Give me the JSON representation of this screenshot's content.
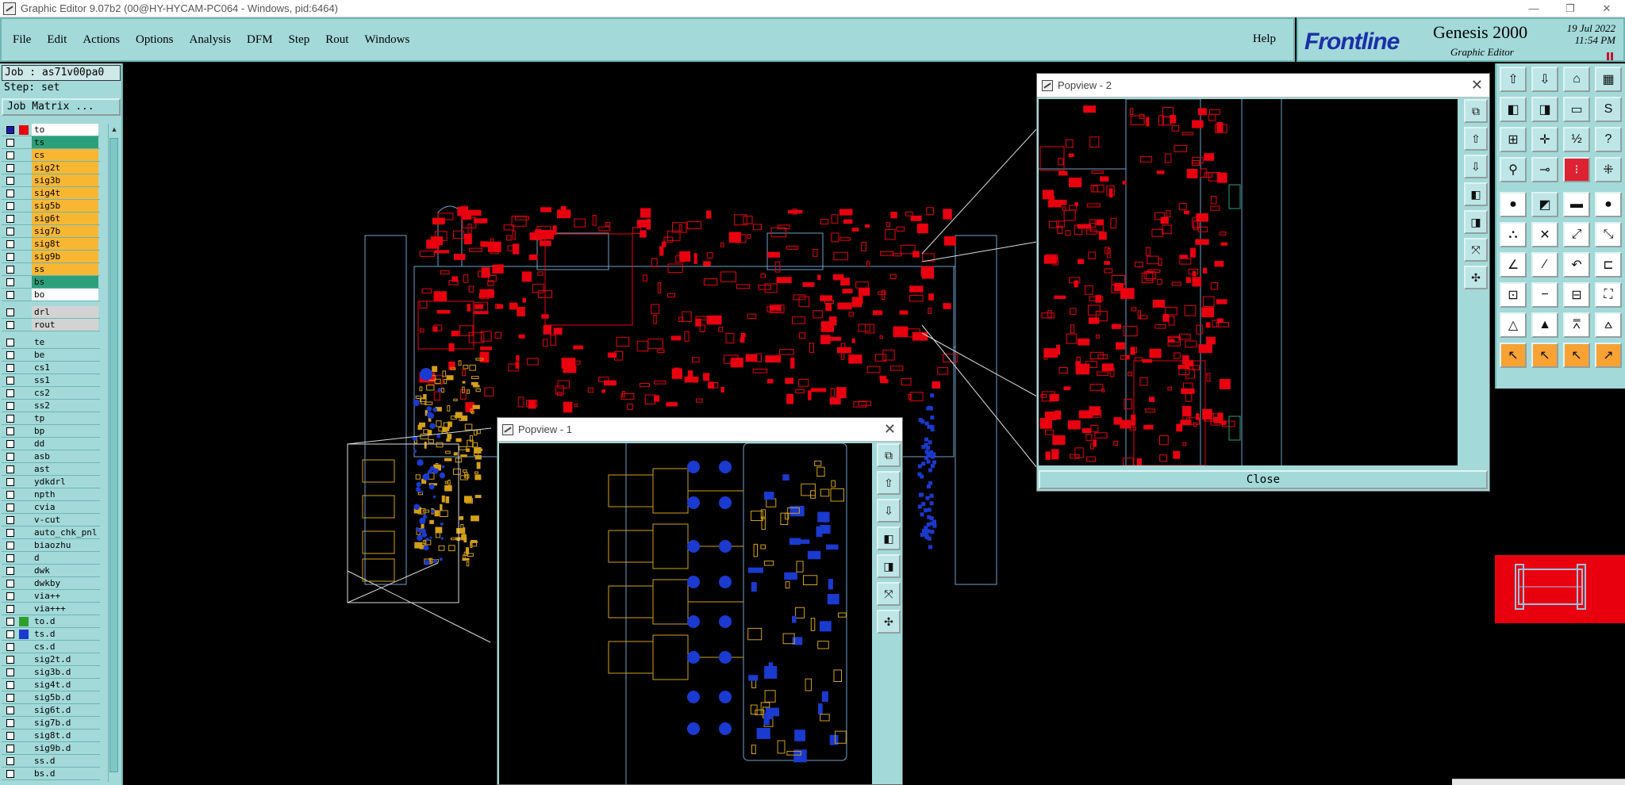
{
  "window": {
    "title": "Graphic Editor 9.07b2 (00@HY-HYCAM-PC064 - Windows, pid:6464)",
    "min_glyph": "—",
    "max_glyph": "❐",
    "close_glyph": "✕"
  },
  "menu": {
    "items": [
      "File",
      "Edit",
      "Actions",
      "Options",
      "Analysis",
      "DFM",
      "Step",
      "Rout",
      "Windows"
    ],
    "help": "Help"
  },
  "brand": {
    "logo": "Frontline",
    "product": "Genesis 2000",
    "subtitle": "Graphic Editor",
    "date": "19 Jul 2022",
    "time": "11:54 PM"
  },
  "left_panel": {
    "job": "Job : as71v00pa0",
    "step": "Step: set",
    "job_matrix": "Job Matrix ...",
    "layers_group1": [
      {
        "name": "to",
        "bg": "#ffffff",
        "swatch": "#e8000f",
        "cb": "#1a1ab0"
      },
      {
        "name": "ts",
        "bg": "#2aa07a",
        "swatch": "",
        "cb": ""
      },
      {
        "name": "cs",
        "bg": "#f7b733",
        "swatch": "",
        "cb": ""
      },
      {
        "name": "sig2t",
        "bg": "#f7b733",
        "swatch": "",
        "cb": ""
      },
      {
        "name": "sig3b",
        "bg": "#f7b733",
        "swatch": "",
        "cb": ""
      },
      {
        "name": "sig4t",
        "bg": "#f7b733",
        "swatch": "",
        "cb": ""
      },
      {
        "name": "sig5b",
        "bg": "#f7b733",
        "swatch": "",
        "cb": ""
      },
      {
        "name": "sig6t",
        "bg": "#f7b733",
        "swatch": "",
        "cb": ""
      },
      {
        "name": "sig7b",
        "bg": "#f7b733",
        "swatch": "",
        "cb": ""
      },
      {
        "name": "sig8t",
        "bg": "#f7b733",
        "swatch": "",
        "cb": ""
      },
      {
        "name": "sig9b",
        "bg": "#f7b733",
        "swatch": "",
        "cb": ""
      },
      {
        "name": "ss",
        "bg": "#f7b733",
        "swatch": "",
        "cb": ""
      },
      {
        "name": "bs",
        "bg": "#2aa07a",
        "swatch": "",
        "cb": ""
      },
      {
        "name": "bo",
        "bg": "#ffffff",
        "swatch": "",
        "cb": ""
      }
    ],
    "layers_group2": [
      {
        "name": "drl",
        "bg": "#d3d3d3",
        "swatch": "",
        "cb": ""
      },
      {
        "name": "rout",
        "bg": "#d3d3d3",
        "swatch": "",
        "cb": ""
      }
    ],
    "layers_group3": [
      {
        "name": "te",
        "bg": "#a3d9d9",
        "swatch": "",
        "cb": ""
      },
      {
        "name": "be",
        "bg": "#a3d9d9",
        "swatch": "",
        "cb": ""
      },
      {
        "name": "cs1",
        "bg": "#a3d9d9",
        "swatch": "",
        "cb": ""
      },
      {
        "name": "ss1",
        "bg": "#a3d9d9",
        "swatch": "",
        "cb": ""
      },
      {
        "name": "cs2",
        "bg": "#a3d9d9",
        "swatch": "",
        "cb": ""
      },
      {
        "name": "ss2",
        "bg": "#a3d9d9",
        "swatch": "",
        "cb": ""
      },
      {
        "name": "tp",
        "bg": "#a3d9d9",
        "swatch": "",
        "cb": ""
      },
      {
        "name": "bp",
        "bg": "#a3d9d9",
        "swatch": "",
        "cb": ""
      },
      {
        "name": "dd",
        "bg": "#a3d9d9",
        "swatch": "",
        "cb": ""
      },
      {
        "name": "asb",
        "bg": "#a3d9d9",
        "swatch": "",
        "cb": ""
      },
      {
        "name": "ast",
        "bg": "#a3d9d9",
        "swatch": "",
        "cb": ""
      },
      {
        "name": "ydkdrl",
        "bg": "#a3d9d9",
        "swatch": "",
        "cb": ""
      },
      {
        "name": "npth",
        "bg": "#a3d9d9",
        "swatch": "",
        "cb": ""
      },
      {
        "name": "cvia",
        "bg": "#a3d9d9",
        "swatch": "",
        "cb": ""
      },
      {
        "name": "v-cut",
        "bg": "#a3d9d9",
        "swatch": "",
        "cb": ""
      },
      {
        "name": "auto_chk_pnl",
        "bg": "#a3d9d9",
        "swatch": "",
        "cb": ""
      },
      {
        "name": "biaozhu",
        "bg": "#a3d9d9",
        "swatch": "",
        "cb": ""
      },
      {
        "name": "d",
        "bg": "#a3d9d9",
        "swatch": "",
        "cb": ""
      },
      {
        "name": "dwk",
        "bg": "#a3d9d9",
        "swatch": "",
        "cb": ""
      },
      {
        "name": "dwkby",
        "bg": "#a3d9d9",
        "swatch": "",
        "cb": ""
      },
      {
        "name": "via++",
        "bg": "#a3d9d9",
        "swatch": "",
        "cb": ""
      },
      {
        "name": "via+++",
        "bg": "#a3d9d9",
        "swatch": "",
        "cb": ""
      },
      {
        "name": "to.d",
        "bg": "#a3d9d9",
        "swatch": "#2aa02a",
        "cb": ""
      },
      {
        "name": "ts.d",
        "bg": "#a3d9d9",
        "swatch": "#1a3ad0",
        "cb": ""
      },
      {
        "name": "cs.d",
        "bg": "#a3d9d9",
        "swatch": "",
        "cb": ""
      },
      {
        "name": "sig2t.d",
        "bg": "#a3d9d9",
        "swatch": "",
        "cb": ""
      },
      {
        "name": "sig3b.d",
        "bg": "#a3d9d9",
        "swatch": "",
        "cb": ""
      },
      {
        "name": "sig4t.d",
        "bg": "#a3d9d9",
        "swatch": "",
        "cb": ""
      },
      {
        "name": "sig5b.d",
        "bg": "#a3d9d9",
        "swatch": "",
        "cb": ""
      },
      {
        "name": "sig6t.d",
        "bg": "#a3d9d9",
        "swatch": "",
        "cb": ""
      },
      {
        "name": "sig7b.d",
        "bg": "#a3d9d9",
        "swatch": "",
        "cb": ""
      },
      {
        "name": "sig8t.d",
        "bg": "#a3d9d9",
        "swatch": "",
        "cb": ""
      },
      {
        "name": "sig9b.d",
        "bg": "#a3d9d9",
        "swatch": "",
        "cb": ""
      },
      {
        "name": "ss.d",
        "bg": "#a3d9d9",
        "swatch": "",
        "cb": ""
      },
      {
        "name": "bs.d",
        "bg": "#a3d9d9",
        "swatch": "",
        "cb": ""
      }
    ]
  },
  "toolbar": {
    "buttons": [
      {
        "name": "zoom-home-icon",
        "glyph": "⇧",
        "style": ""
      },
      {
        "name": "zoom-down-icon",
        "glyph": "⇩",
        "style": ""
      },
      {
        "name": "home-icon",
        "glyph": "⌂",
        "style": ""
      },
      {
        "name": "grid-icon",
        "glyph": "▦",
        "style": ""
      },
      {
        "name": "zoom-left-icon",
        "glyph": "◧",
        "style": ""
      },
      {
        "name": "zoom-right-icon",
        "glyph": "◨",
        "style": ""
      },
      {
        "name": "window-icon",
        "glyph": "▭",
        "style": ""
      },
      {
        "name": "snap-icon",
        "glyph": "S",
        "style": ""
      },
      {
        "name": "fit-icon",
        "glyph": "⊞",
        "style": ""
      },
      {
        "name": "center-icon",
        "glyph": "✛",
        "style": ""
      },
      {
        "name": "scale-icon",
        "glyph": "½",
        "style": ""
      },
      {
        "name": "help-icon",
        "glyph": "?",
        "style": ""
      },
      {
        "name": "measure-icon",
        "glyph": "⚲",
        "style": ""
      },
      {
        "name": "probe-icon",
        "glyph": "⊸",
        "style": ""
      },
      {
        "name": "net-icon",
        "glyph": "⁝",
        "style": "red"
      },
      {
        "name": "route-icon",
        "glyph": "⁜",
        "style": ""
      },
      {
        "name": "pad-icon",
        "glyph": "●",
        "style": "white"
      },
      {
        "name": "line-icon",
        "glyph": "◩",
        "style": ""
      },
      {
        "name": "ruler-icon",
        "glyph": "▬",
        "style": "white"
      },
      {
        "name": "dot-icon",
        "glyph": "●",
        "style": "white"
      },
      {
        "name": "connect-icon",
        "glyph": "⛬",
        "style": "white"
      },
      {
        "name": "cross-icon",
        "glyph": "✕",
        "style": "white"
      },
      {
        "name": "link-icon",
        "glyph": "⤢",
        "style": "white"
      },
      {
        "name": "link2-icon",
        "glyph": "⤡",
        "style": "white"
      },
      {
        "name": "angle-icon",
        "glyph": "∠",
        "style": "white"
      },
      {
        "name": "diag-icon",
        "glyph": "⁄",
        "style": "white"
      },
      {
        "name": "arc-icon",
        "glyph": "↶",
        "style": "white"
      },
      {
        "name": "bracket-icon",
        "glyph": "⊏",
        "style": "white"
      },
      {
        "name": "node-icon",
        "glyph": "⊡",
        "style": "white"
      },
      {
        "name": "minus-icon",
        "glyph": "−",
        "style": "white"
      },
      {
        "name": "box-icon",
        "glyph": "⊟",
        "style": "white"
      },
      {
        "name": "cluster-icon",
        "glyph": "⛶",
        "style": "white"
      },
      {
        "name": "tri1-icon",
        "glyph": "△",
        "style": "white"
      },
      {
        "name": "tri2-icon",
        "glyph": "▲",
        "style": "white"
      },
      {
        "name": "tri3-icon",
        "glyph": "⩞",
        "style": "white"
      },
      {
        "name": "tri4-icon",
        "glyph": "⩟",
        "style": "white"
      },
      {
        "name": "pointer-icon",
        "glyph": "↖",
        "style": "orange"
      },
      {
        "name": "pointer2-icon",
        "glyph": "↖",
        "style": "orange"
      },
      {
        "name": "pointer3-icon",
        "glyph": "↖",
        "style": "orange"
      },
      {
        "name": "pointer4-icon",
        "glyph": "↗",
        "style": "orange"
      }
    ]
  },
  "popview2": {
    "title": "Popview - 2",
    "close_label": "Close"
  },
  "popview1": {
    "title": "Popview - 1"
  },
  "popside_buttons": [
    {
      "name": "pv-fit-icon",
      "glyph": "⧉"
    },
    {
      "name": "pv-zoom-in-icon",
      "glyph": "⇧"
    },
    {
      "name": "pv-zoom-out-icon",
      "glyph": "⇩"
    },
    {
      "name": "pv-left-icon",
      "glyph": "◧"
    },
    {
      "name": "pv-right-icon",
      "glyph": "◨"
    },
    {
      "name": "pv-expand-icon",
      "glyph": "⤧"
    },
    {
      "name": "pv-center-icon",
      "glyph": "✣"
    }
  ],
  "colors": {
    "panel": "#a3d9d9",
    "layer_red": "#e8000f",
    "layer_yellow": "#d4a017",
    "layer_blue": "#1a3ad0",
    "profile": "#6fa0c8"
  }
}
